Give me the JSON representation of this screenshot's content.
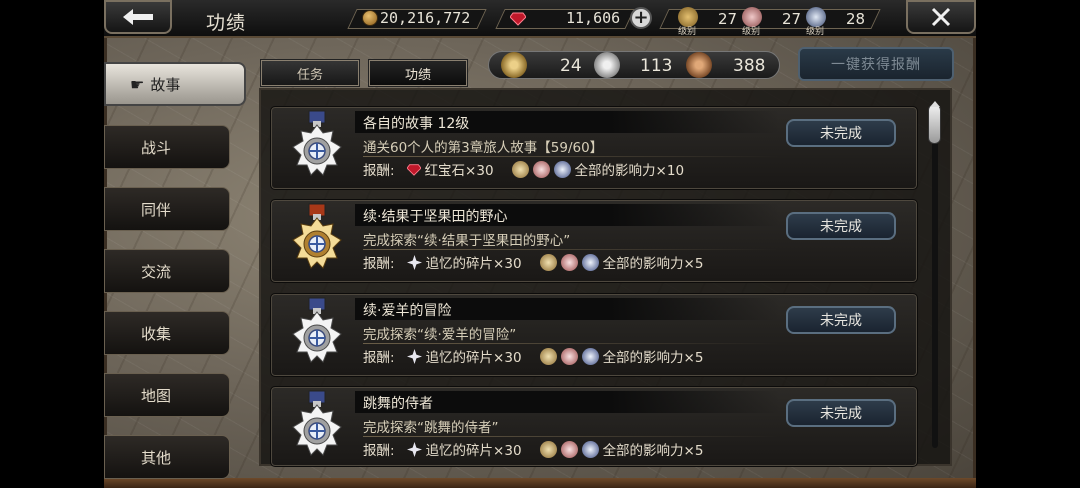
{
  "header": {
    "title": "功绩",
    "gold": "20,216,772",
    "rubies": "11,606",
    "rank_label": "级别",
    "badge_counts": [
      "27",
      "27",
      "28"
    ]
  },
  "sidebar": {
    "items": [
      {
        "label": "故事",
        "active": true
      },
      {
        "label": "战斗"
      },
      {
        "label": "同伴"
      },
      {
        "label": "交流"
      },
      {
        "label": "收集"
      },
      {
        "label": "地图"
      },
      {
        "label": "其他"
      }
    ]
  },
  "tabs": [
    {
      "label": "任务",
      "active": false
    },
    {
      "label": "功绩",
      "active": true
    }
  ],
  "summary": {
    "gold_medals": "24",
    "silver_medals": "113",
    "bronze_medals": "388"
  },
  "claim_all_label": "一键获得报酬",
  "reward_label": "报酬:",
  "achievements": [
    {
      "title": "各自的故事  12级",
      "description": "通关60个人的第3章旅人故事【59/60】",
      "reward_item": "红宝石×30",
      "reward_item_icon": "ruby-icon",
      "influence": "全部的影响力×10",
      "status": "未完成",
      "medal": "silver"
    },
    {
      "title": "续·结果于坚果田的野心",
      "description": "完成探索“续·结果于坚果田的野心”",
      "reward_item": "追忆的碎片×30",
      "reward_item_icon": "memory-shard-icon",
      "influence": "全部的影响力×5",
      "status": "未完成",
      "medal": "gold"
    },
    {
      "title": "续·爱羊的冒险",
      "description": "完成探索“续·爱羊的冒险”",
      "reward_item": "追忆的碎片×30",
      "reward_item_icon": "memory-shard-icon",
      "influence": "全部的影响力×5",
      "status": "未完成",
      "medal": "silver"
    },
    {
      "title": "跳舞的侍者",
      "description": "完成探索“跳舞的侍者”",
      "reward_item": "追忆的碎片×30",
      "reward_item_icon": "memory-shard-icon",
      "influence": "全部的影响力×5",
      "status": "未完成",
      "medal": "silver"
    }
  ],
  "colors": {
    "accent_blue": "#2e3c4a",
    "ruby": "#c0182a",
    "gold_medal": "#d8b050",
    "silver_medal": "#d8d8d8"
  }
}
